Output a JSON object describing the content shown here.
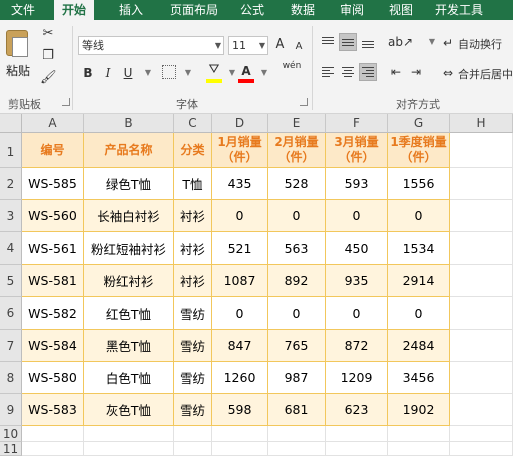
{
  "ribbon_tabs": [
    "文件",
    "开始",
    "插入",
    "页面布局",
    "公式",
    "数据",
    "审阅",
    "视图",
    "开发工具"
  ],
  "active_tab": "开始",
  "clipboard": {
    "paste_label": "粘贴",
    "group_label": "剪贴板"
  },
  "font": {
    "family": "等线",
    "size": "11",
    "bold": "B",
    "italic": "I",
    "underline": "U",
    "phonetic": "wén",
    "group_label": "字体",
    "grow": "A",
    "shrink": "A",
    "font_color_glyph": "A"
  },
  "alignment": {
    "wrap_text": "自动换行",
    "merge_center": "合并后居中",
    "group_label": "对齐方式"
  },
  "colors": {
    "ribbon_green": "#217346",
    "header_fill": "#fde9c8",
    "header_text": "#e77a1e",
    "band_fill": "#fff4dd",
    "border": "#f2c75c"
  },
  "columns": [
    "A",
    "B",
    "C",
    "D",
    "E",
    "F",
    "G",
    "H"
  ],
  "rows": [
    "1",
    "2",
    "3",
    "4",
    "5",
    "6",
    "7",
    "8",
    "9",
    "10",
    "11"
  ],
  "table": {
    "headers": [
      "编号",
      "产品名称",
      "分类",
      "1月销量（件）",
      "2月销量（件）",
      "3月销量（件）",
      "1季度销量（件）"
    ],
    "rows": [
      [
        "WS-585",
        "绿色T恤",
        "T恤",
        "435",
        "528",
        "593",
        "1556"
      ],
      [
        "WS-560",
        "长袖白衬衫",
        "衬衫",
        "0",
        "0",
        "0",
        "0"
      ],
      [
        "WS-561",
        "粉红短袖衬衫",
        "衬衫",
        "521",
        "563",
        "450",
        "1534"
      ],
      [
        "WS-581",
        "粉红衬衫",
        "衬衫",
        "1087",
        "892",
        "935",
        "2914"
      ],
      [
        "WS-582",
        "红色T恤",
        "雪纺",
        "0",
        "0",
        "0",
        "0"
      ],
      [
        "WS-584",
        "黑色T恤",
        "雪纺",
        "847",
        "765",
        "872",
        "2484"
      ],
      [
        "WS-580",
        "白色T恤",
        "雪纺",
        "1260",
        "987",
        "1209",
        "3456"
      ],
      [
        "WS-583",
        "灰色T恤",
        "雪纺",
        "598",
        "681",
        "623",
        "1902"
      ]
    ]
  },
  "icons": {
    "paste": "clipboard-paste-icon",
    "cut": "scissors-icon",
    "copy": "copy-icon",
    "format_painter": "paintbrush-icon"
  }
}
